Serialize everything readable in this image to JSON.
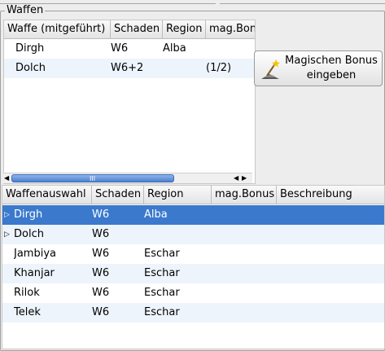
{
  "frame": {
    "title": "Waffen"
  },
  "upper_table": {
    "columns": [
      "Waffe (mitgeführt)",
      "Schaden",
      "Region",
      "mag.Bonus"
    ],
    "rows": [
      [
        "Dirgh",
        "W6",
        "Alba",
        ""
      ],
      [
        "Dolch",
        "W6+2",
        "",
        "(1/2)"
      ]
    ],
    "scrollbar_grip": "III"
  },
  "mag_button": {
    "line1": "Magischen Bonus",
    "line2": "eingeben",
    "icon": "wand-icon"
  },
  "lower_table": {
    "columns": [
      "Waffenauswahl",
      "Schaden",
      "Region",
      "mag.Bonus",
      "Beschreibung"
    ],
    "rows": [
      {
        "expander": "▷",
        "cells": [
          "Dirgh",
          "W6",
          "Alba",
          "",
          ""
        ],
        "selected": true
      },
      {
        "expander": "▷",
        "cells": [
          "Dolch",
          "W6",
          "",
          "",
          ""
        ],
        "selected": false
      },
      {
        "expander": "",
        "cells": [
          "Jambiya",
          "W6",
          "Eschar",
          "",
          ""
        ],
        "selected": false
      },
      {
        "expander": "",
        "cells": [
          "Khanjar",
          "W6",
          "Eschar",
          "",
          ""
        ],
        "selected": false
      },
      {
        "expander": "",
        "cells": [
          "Rilok",
          "W6",
          "Eschar",
          "",
          ""
        ],
        "selected": false
      },
      {
        "expander": "",
        "cells": [
          "Telek",
          "W6",
          "Eschar",
          "",
          ""
        ],
        "selected": false
      }
    ]
  },
  "colors": {
    "selection": "#3b79cc",
    "alt_row": "#eef4fc"
  }
}
